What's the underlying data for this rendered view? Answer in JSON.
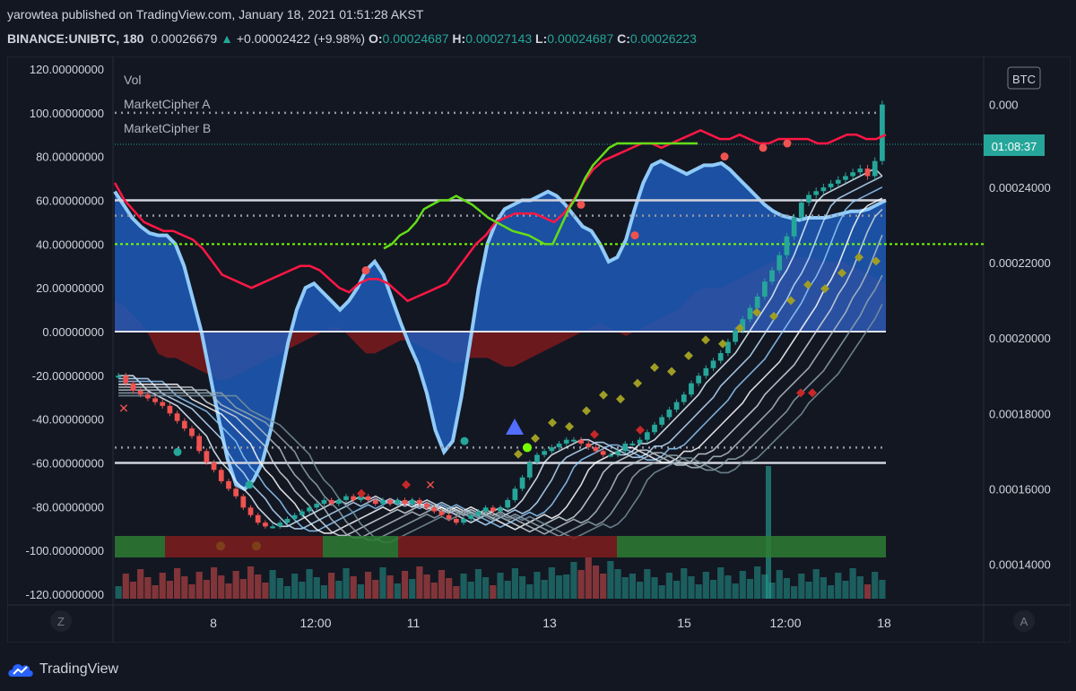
{
  "header": {
    "published_line": "yarowtea published on TradingView.com, January 18, 2021 01:51:28 AKST",
    "author": "yarowtea",
    "symbol": "BINANCE:UNIBTC, 180",
    "price": "0.00026679",
    "change_arrow": "▲",
    "change": "+0.00002422 (+9.98%)",
    "ohlc": [
      {
        "label": "O:",
        "value": "0.00024687"
      },
      {
        "label": "H:",
        "value": "0.00027143"
      },
      {
        "label": "L:",
        "value": "0.00024687"
      },
      {
        "label": "C:",
        "value": "0.00026223"
      }
    ]
  },
  "brand": "TradingView",
  "colors": {
    "background": "#131722",
    "up": "#26a69a",
    "down": "#ef5350",
    "wave_blue": "#2962ff",
    "money_flow_green": "#8bc34a",
    "red_line": "#ff1744"
  },
  "chart_data": {
    "type": "candlestick",
    "indicator_labels": [
      "Vol",
      "MarketCipher A",
      "MarketCipher B"
    ],
    "currency_badge": "BTC",
    "countdown": "01:08:37",
    "left_axis_ticks": [
      "120.00000000",
      "100.00000000",
      "80.00000000",
      "60.00000000",
      "40.00000000",
      "20.00000000",
      "0.00000000",
      "-20.00000000",
      "-40.00000000",
      "-60.00000000",
      "-80.00000000",
      "-100.00000000",
      "-120.00000000"
    ],
    "right_axis_ticks": [
      "0.000",
      "0.00024000",
      "0.00022000",
      "0.00020000",
      "0.00018000",
      "0.00016000",
      "0.00014000"
    ],
    "x_axis_labels": [
      "8",
      "12:00",
      "11",
      "13",
      "15",
      "12:00",
      "18"
    ],
    "bottom_left_button": "Z",
    "bottom_right_button": "A",
    "osc_range": [
      -120,
      120
    ],
    "price_range": [
      0.000132,
      0.00027
    ],
    "levels": {
      "overbought_solid": 60,
      "overbought_dotted": 53,
      "mid_green_dotted": 40,
      "top_dotted": 100,
      "oversold_solid": -60,
      "oversold_dotted": -53
    },
    "close_price": [
      0.00019,
      0.000188,
      0.000186,
      0.000185,
      0.000184,
      0.000183,
      0.000182,
      0.00018,
      0.000178,
      0.000176,
      0.000174,
      0.00017,
      0.000167,
      0.000165,
      0.000162,
      0.00016,
      0.000158,
      0.000155,
      0.000153,
      0.000151,
      0.00015,
      0.00015,
      0.000151,
      0.000152,
      0.000153,
      0.000154,
      0.000155,
      0.000156,
      0.000157,
      0.000156,
      0.000157,
      0.000158,
      0.000157,
      0.000158,
      0.000157,
      0.000156,
      0.000157,
      0.000156,
      0.000157,
      0.000156,
      0.000157,
      0.000156,
      0.000155,
      0.000154,
      0.000153,
      0.000152,
      0.000151,
      0.000152,
      0.000153,
      0.000154,
      0.000155,
      0.000154,
      0.000155,
      0.000157,
      0.00016,
      0.000163,
      0.000167,
      0.000169,
      0.00017,
      0.000171,
      0.000172,
      0.000173,
      0.000173,
      0.000172,
      0.000171,
      0.00017,
      0.000169,
      0.000169,
      0.00017,
      0.000172,
      0.000172,
      0.000173,
      0.000175,
      0.000177,
      0.000179,
      0.000181,
      0.000183,
      0.000185,
      0.000188,
      0.00019,
      0.000192,
      0.000194,
      0.000196,
      0.000199,
      0.000202,
      0.000205,
      0.000208,
      0.000211,
      0.000215,
      0.000218,
      0.000222,
      0.000227,
      0.000232,
      0.000236,
      0.000238,
      0.000239,
      0.00024,
      0.000241,
      0.000242,
      0.000243,
      0.000244,
      0.000245,
      0.000243,
      0.000247,
      0.000262
    ],
    "wt1": [
      64,
      58,
      52,
      48,
      45,
      44,
      44,
      40,
      30,
      15,
      0,
      -20,
      -40,
      -58,
      -70,
      -72,
      -68,
      -60,
      -45,
      -25,
      -5,
      10,
      20,
      22,
      18,
      14,
      10,
      14,
      20,
      28,
      32,
      26,
      15,
      4,
      -6,
      -15,
      -28,
      -45,
      -55,
      -50,
      -30,
      -5,
      20,
      40,
      50,
      56,
      58,
      60,
      60,
      62,
      64,
      62,
      58,
      53,
      48,
      46,
      40,
      32,
      34,
      42,
      56,
      68,
      76,
      78,
      76,
      74,
      72,
      74,
      76,
      76,
      77,
      74,
      70,
      66,
      62,
      58,
      55,
      53,
      52,
      51,
      52,
      52,
      52,
      53,
      54,
      55,
      55,
      56,
      58,
      60
    ],
    "rsi_mfi": [
      14,
      12,
      8,
      4,
      -2,
      -10,
      -12,
      -12,
      -14,
      -16,
      -18,
      -20,
      -22,
      -22,
      -20,
      -18,
      -16,
      -14,
      -12,
      -10,
      -8,
      -6,
      -4,
      -2,
      0,
      2,
      2,
      -2,
      -6,
      -10,
      -10,
      -8,
      -6,
      -4,
      -4,
      -6,
      -8,
      -10,
      -12,
      -14,
      -14,
      -12,
      -12,
      -12,
      -14,
      -16,
      -16,
      -14,
      -12,
      -10,
      -8,
      -6,
      -4,
      -2,
      0,
      2,
      4,
      2,
      0,
      -2,
      0,
      2,
      4,
      6,
      8,
      10,
      14,
      18,
      20,
      20,
      20,
      22,
      24,
      26,
      28,
      30,
      32,
      34,
      34,
      34,
      34,
      33,
      32,
      32,
      32,
      30,
      28,
      26,
      24,
      22
    ],
    "red_line": [
      68,
      60,
      55,
      50,
      48,
      46,
      46,
      44,
      42,
      38,
      32,
      26,
      24,
      22,
      20,
      22,
      24,
      26,
      28,
      30,
      30,
      28,
      24,
      20,
      18,
      22,
      24,
      24,
      22,
      18,
      14,
      16,
      18,
      20,
      22,
      28,
      34,
      40,
      44,
      50,
      52,
      54,
      54,
      54,
      52,
      50,
      54,
      60,
      68,
      74,
      78,
      80,
      82,
      84,
      86,
      86,
      84,
      86,
      88,
      90,
      92,
      90,
      88,
      88,
      90,
      88,
      86,
      86,
      88,
      88,
      88,
      88,
      86,
      86,
      88,
      90,
      90,
      88,
      88,
      90
    ],
    "green_wave": [
      38,
      40,
      44,
      46,
      50,
      56,
      58,
      60,
      60,
      62,
      60,
      58,
      55,
      52,
      50,
      48,
      46,
      45,
      44,
      42,
      40,
      40,
      48,
      56,
      62,
      70,
      76,
      80,
      84,
      86,
      86,
      86,
      86,
      86,
      86,
      86,
      86,
      86,
      86,
      86
    ]
  }
}
